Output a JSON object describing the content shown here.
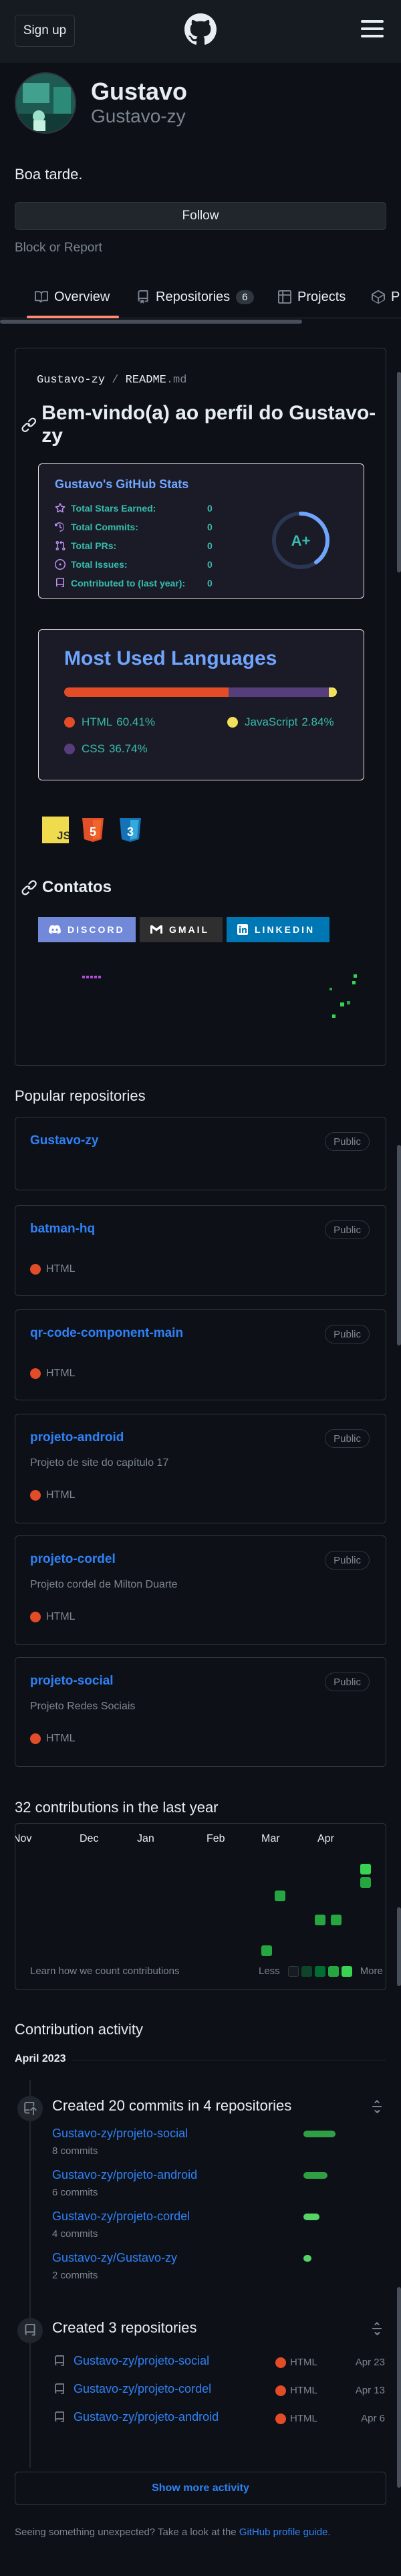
{
  "header": {
    "signup_label": "Sign up"
  },
  "profile": {
    "name": "Gustavo",
    "login": "Gustavo-zy",
    "bio": "Boa tarde.",
    "follow_label": "Follow",
    "block_label": "Block or Report"
  },
  "tabs": [
    {
      "label": "Overview",
      "icon": "book-icon"
    },
    {
      "label": "Repositories",
      "icon": "repo-icon",
      "count": "6"
    },
    {
      "label": "Projects",
      "icon": "table-icon"
    },
    {
      "label": "P",
      "icon": "package-icon"
    }
  ],
  "readme": {
    "owner": "Gustavo-zy",
    "sep": " / ",
    "file": "README",
    "ext": ".md",
    "heading": "Bem-vindo(a) ao perfil do Gustavo-zy",
    "stats": {
      "title": "Gustavo's GitHub Stats",
      "rows": [
        {
          "label": "Total Stars Earned:",
          "value": "0",
          "icon": "star-icon"
        },
        {
          "label": "Total Commits:",
          "value": "0",
          "icon": "history-icon"
        },
        {
          "label": "Total PRs:",
          "value": "0",
          "icon": "pull-request-icon"
        },
        {
          "label": "Total Issues:",
          "value": "0",
          "icon": "issue-icon"
        },
        {
          "label": "Contributed to (last year):",
          "value": "0",
          "icon": "repo-icon"
        }
      ],
      "rank": "A+",
      "accent": "#70a5fd",
      "text_color": "#38bdae"
    },
    "languages": {
      "title": "Most Used Languages",
      "items": [
        {
          "name": "HTML",
          "percent": 60.41,
          "label": "60.41%",
          "color": "#e34c26"
        },
        {
          "name": "JavaScript",
          "percent": 2.84,
          "label": "2.84%",
          "color": "#f1e05a"
        },
        {
          "name": "CSS",
          "percent": 36.74,
          "label": "36.74%",
          "color": "#563d7c"
        }
      ]
    },
    "tech_icons": [
      "javascript-icon",
      "html5-icon",
      "css3-icon"
    ],
    "tech_labels": [
      "JS",
      "5",
      "3"
    ],
    "contacts_heading": "Contatos",
    "badges": [
      {
        "label": "DISCORD",
        "icon": "discord-icon",
        "color": "#7289da"
      },
      {
        "label": "GMAIL",
        "icon": "gmail-icon",
        "color": "#2f2f2f"
      },
      {
        "label": "LINKEDIN",
        "icon": "linkedin-icon",
        "color": "#0077b5"
      }
    ]
  },
  "popular": {
    "heading": "Popular repositories",
    "repos": [
      {
        "name": "Gustavo-zy",
        "visibility": "Public",
        "description": "",
        "language": ""
      },
      {
        "name": "batman-hq",
        "visibility": "Public",
        "description": "",
        "language": "HTML"
      },
      {
        "name": "qr-code-component-main",
        "visibility": "Public",
        "description": "",
        "language": "HTML"
      },
      {
        "name": "projeto-android",
        "visibility": "Public",
        "description": "Projeto de site do capítulo 17",
        "language": "HTML"
      },
      {
        "name": "projeto-cordel",
        "visibility": "Public",
        "description": "Projeto cordel de Milton Duarte",
        "language": "HTML"
      },
      {
        "name": "projeto-social",
        "visibility": "Public",
        "description": "Projeto Redes Sociais",
        "language": "HTML"
      }
    ]
  },
  "contributions": {
    "heading": "32 contributions in the last year",
    "months": [
      "Nov",
      "Dec",
      "Jan",
      "Feb",
      "Mar",
      "Apr"
    ],
    "learn_label": "Learn how we count contributions",
    "less_label": "Less",
    "more_label": "More",
    "legend_colors": [
      "#161b22",
      "#0e4429",
      "#006d32",
      "#26a641",
      "#39d353"
    ]
  },
  "activity": {
    "heading": "Contribution activity",
    "period": "April 2023",
    "commits": {
      "title": "Created 20 commits in 4 repositories",
      "repos": [
        {
          "name": "Gustavo-zy/projeto-social",
          "count": "8 commits",
          "commits": 8
        },
        {
          "name": "Gustavo-zy/projeto-android",
          "count": "6 commits",
          "commits": 6
        },
        {
          "name": "Gustavo-zy/projeto-cordel",
          "count": "4 commits",
          "commits": 4
        },
        {
          "name": "Gustavo-zy/Gustavo-zy",
          "count": "2 commits",
          "commits": 2
        }
      ]
    },
    "created": {
      "title": "Created 3 repositories",
      "repos": [
        {
          "name": "Gustavo-zy/projeto-social",
          "language": "HTML",
          "date": "Apr 23"
        },
        {
          "name": "Gustavo-zy/projeto-cordel",
          "language": "HTML",
          "date": "Apr 13"
        },
        {
          "name": "Gustavo-zy/projeto-android",
          "language": "HTML",
          "date": "Apr 6"
        }
      ]
    },
    "show_more_label": "Show more activity"
  },
  "footer": {
    "text": "Seeing something unexpected? Take a look at the ",
    "link": "GitHub profile guide",
    "end": "."
  }
}
